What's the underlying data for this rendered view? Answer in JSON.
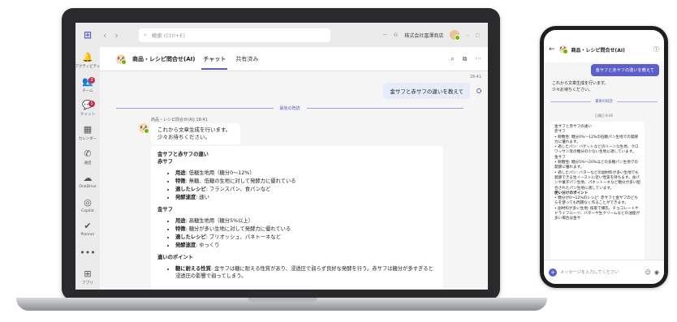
{
  "topbar": {
    "search_placeholder": "検索 (Ctrl+E)",
    "org_name": "株式会社冨澤商店"
  },
  "rail": [
    {
      "label": "アクティビティ",
      "icon": "bell-icon",
      "glyph": "🔔",
      "badge": ""
    },
    {
      "label": "チーム",
      "icon": "teams-icon",
      "glyph": "👥",
      "badge": "3"
    },
    {
      "label": "チャット",
      "icon": "chat-icon",
      "glyph": "💬",
      "badge": "1"
    },
    {
      "label": "カレンダー",
      "icon": "calendar-icon",
      "glyph": "▦",
      "badge": ""
    },
    {
      "label": "通話",
      "icon": "phone-icon",
      "glyph": "✆",
      "badge": ""
    },
    {
      "label": "OneDrive",
      "icon": "cloud-icon",
      "glyph": "☁",
      "badge": ""
    },
    {
      "label": "Copilot",
      "icon": "copilot-icon",
      "glyph": "◎",
      "badge": ""
    },
    {
      "label": "Planner",
      "icon": "planner-icon",
      "glyph": "✔",
      "badge": ""
    },
    {
      "label": "",
      "icon": "more-icon",
      "glyph": "•••",
      "badge": ""
    },
    {
      "label": "アプリ",
      "icon": "apps-icon",
      "glyph": "⊞",
      "badge": ""
    }
  ],
  "chat": {
    "title": "商品・レシピ問合せ(AI)",
    "tabs": [
      "チャット",
      "共有済み"
    ],
    "user_time": "18:41",
    "user_message": "金サフと赤サフの違いを教えて",
    "divider": "最後の既読",
    "bot_meta": "商品・レシピ問合せ(AI) 18:41",
    "bot_message_1": "これから文章生成を行います。",
    "bot_message_2": "少々お待ちください。",
    "answer": {
      "title": "金サフと赤サフの違い",
      "sections": [
        {
          "heading": "赤サフ",
          "items": [
            {
              "label": "用途",
              "value": ": 低糖生地用（糖分0〜12%）"
            },
            {
              "label": "特徴",
              "value": ": 無糖、低糖の生地に対して発酵力に優れている"
            },
            {
              "label": "適したレシピ",
              "value": ": フランスパン、食パンなど"
            },
            {
              "label": "発酵速度",
              "value": ": 速い"
            }
          ]
        },
        {
          "heading": "金サフ",
          "items": [
            {
              "label": "用途",
              "value": ": 高糖生地用（糖分5%以上）"
            },
            {
              "label": "特徴",
              "value": ": 糖分が多い生地に対して発酵力に優れている"
            },
            {
              "label": "適したレシピ",
              "value": ": ブリオッシュ、パネトーネなど"
            },
            {
              "label": "発酵速度",
              "value": ": ゆっくり"
            }
          ]
        },
        {
          "heading": "違いのポイント",
          "items": [
            {
              "label": "糖に耐える性質",
              "value": ": 金サフは糖に耐える性質があり、浸透圧で弱らず良好な発酵を行う。赤サフは糖分が多すぎると浸透圧の影響で弱ってしまう。"
            }
          ]
        }
      ]
    }
  },
  "phone": {
    "title": "商品・レシピ問合せ(AI)",
    "user_message": "金サフと赤サフの違いを教えて",
    "bot_message_1": "これから文章生成を行います。",
    "bot_message_2": "少々お待ちください。",
    "divider": "最後の既読",
    "time": "日曜日 8:46",
    "lines": [
      {
        "text": "金サフと赤サフの違い",
        "bold": false
      },
      {
        "text": "赤サフ",
        "bold": false
      },
      {
        "text": "• 耐糖性: 糖分0%〜12%の低糖パン生地での発酵力に優れます。",
        "bold": false
      },
      {
        "text": "• 適したパン: バゲットなどのリーンな生地、クロワッサン等の糖分の少ない生地に適しています。",
        "bold": false
      },
      {
        "text": "金サフ",
        "bold": false
      },
      {
        "text": "• 耐糖性: 糖分5%〜20%ほどの多糖パン生地での発酵に優れます。",
        "bold": false
      },
      {
        "text": "• 適したパン: バターなどの副材料が多い生地でも発酵できる生イーストに近い性質を持ちます。食パンや菓子パン生地、パネットーネなど糖分が多い配合されたパン生地に適しています。",
        "bold": false
      },
      {
        "text": "使い分けのポイント",
        "bold": true
      },
      {
        "text": "• 糖分が0〜12%のレシピ: 赤サフと金サフのどちらを使っても問題なく作ることができます。",
        "bold": false
      },
      {
        "text": "• 副材料が多い生地: 核家で練乳、チョコレートやドライフルーツ、バターや生クリームなどの油脂が多い場合は金サ",
        "bold": false
      }
    ],
    "input_placeholder": "メッセージを入力してください"
  }
}
